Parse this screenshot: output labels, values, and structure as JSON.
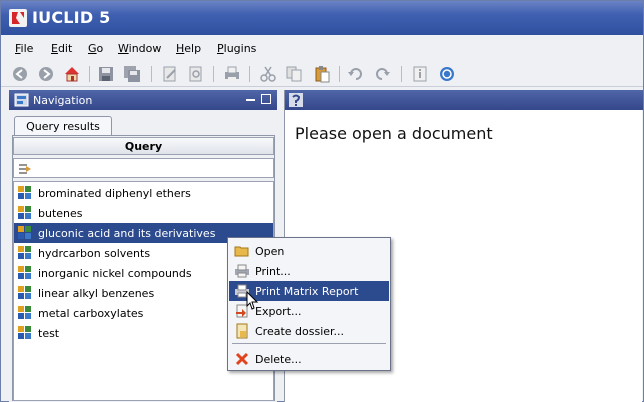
{
  "app": {
    "title": "IUCLID 5"
  },
  "menu": [
    {
      "label": "File",
      "mnemonic": "F",
      "rest": "ile"
    },
    {
      "label": "Edit",
      "mnemonic": "E",
      "rest": "dit"
    },
    {
      "label": "Go",
      "mnemonic": "G",
      "rest": "o"
    },
    {
      "label": "Window",
      "mnemonic": "W",
      "rest": "indow"
    },
    {
      "label": "Help",
      "mnemonic": "H",
      "rest": "elp"
    },
    {
      "label": "Plugins",
      "mnemonic": "P",
      "rest": "lugins"
    }
  ],
  "toolbar_icons": [
    "back-icon",
    "forward-icon",
    "home-icon",
    "save-icon",
    "save-all-icon",
    "edit-icon",
    "preview-icon",
    "print-icon",
    "cut-icon",
    "copy-icon",
    "paste-icon",
    "undo-icon",
    "redo-icon",
    "document-info-icon",
    "help-icon"
  ],
  "navigation": {
    "title": "Navigation",
    "tab": "Query results",
    "column_header": "Query",
    "items": [
      {
        "label": "brominated diphenyl ethers",
        "selected": false
      },
      {
        "label": "butenes",
        "selected": false
      },
      {
        "label": "gluconic acid and its derivatives",
        "selected": true
      },
      {
        "label": "hydrcarbon solvents",
        "selected": false
      },
      {
        "label": "inorganic nickel compounds",
        "selected": false
      },
      {
        "label": "linear alkyl benzenes",
        "selected": false
      },
      {
        "label": "metal carboxylates",
        "selected": false
      },
      {
        "label": "test",
        "selected": false
      }
    ]
  },
  "document": {
    "message": "Please open a document"
  },
  "context_menu": {
    "items": [
      {
        "label": "Open",
        "icon": "folder-open-icon",
        "highlighted": false
      },
      {
        "label": "Print...",
        "icon": "print-icon",
        "highlighted": false
      },
      {
        "label": "Print Matrix Report",
        "icon": "print-matrix-icon",
        "highlighted": true
      },
      {
        "label": "Export...",
        "icon": "export-icon",
        "highlighted": false
      },
      {
        "label": "Create dossier...",
        "icon": "create-dossier-icon",
        "highlighted": false
      },
      {
        "label": "Delete...",
        "icon": "delete-icon",
        "highlighted": false
      }
    ]
  },
  "colors": {
    "titlebar": "#3f5fb0",
    "selection": "#2c4a8e",
    "panel_header": "#34478a"
  }
}
